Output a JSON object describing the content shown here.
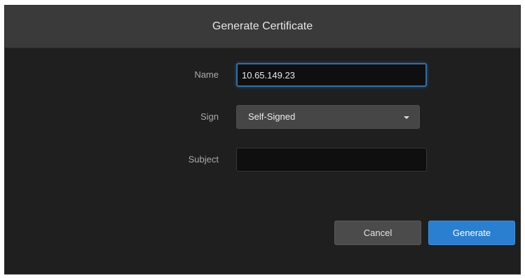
{
  "dialog": {
    "title": "Generate Certificate"
  },
  "form": {
    "name": {
      "label": "Name",
      "value": "10.65.149.23"
    },
    "sign": {
      "label": "Sign",
      "selected": "Self-Signed"
    },
    "subject": {
      "label": "Subject",
      "value": ""
    }
  },
  "buttons": {
    "cancel_label": "Cancel",
    "generate_label": "Generate"
  },
  "colors": {
    "dialog_bg": "#1f1f1f",
    "header_bg": "#3a3a3a",
    "primary_button": "#2a7fd0",
    "secondary_button": "#4b4b4b",
    "focus_border": "#2f6fa6"
  }
}
